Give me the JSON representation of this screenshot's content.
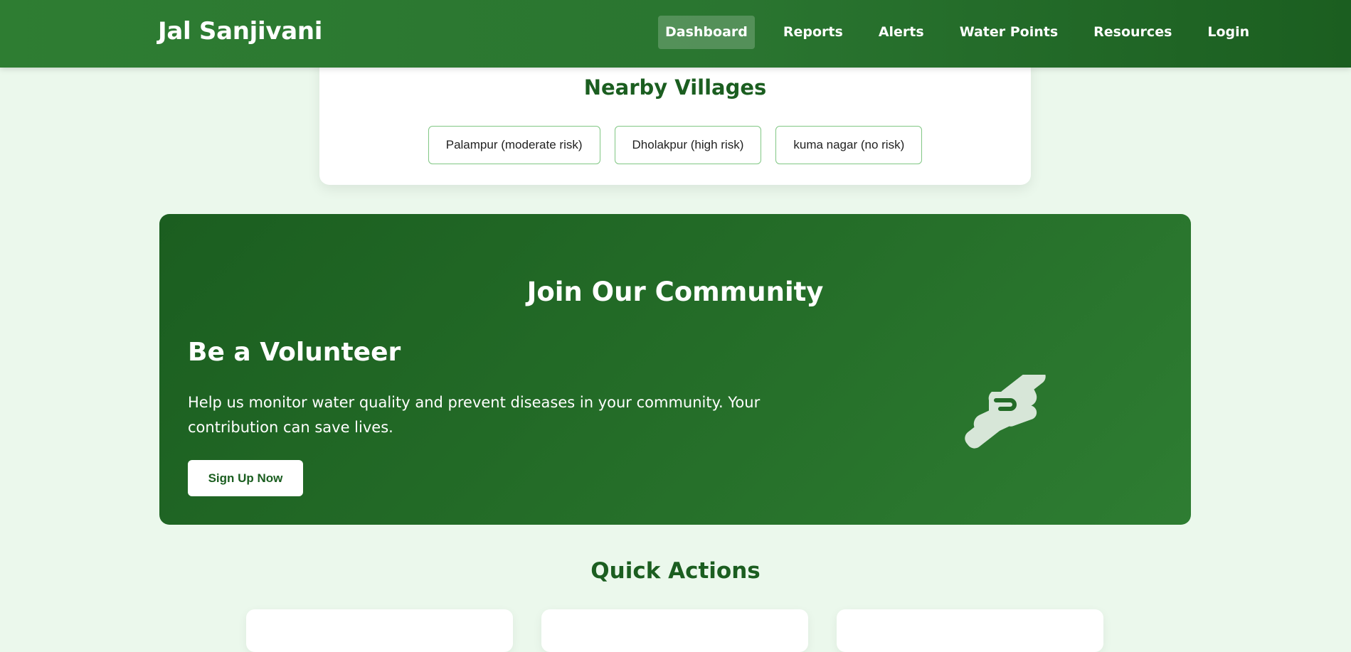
{
  "navbar": {
    "brand": "Jal Sanjivani",
    "links": [
      {
        "label": "Dashboard",
        "active": true
      },
      {
        "label": "Reports"
      },
      {
        "label": "Alerts"
      },
      {
        "label": "Water Points"
      },
      {
        "label": "Resources"
      },
      {
        "label": "Login"
      }
    ]
  },
  "nearby_villages": {
    "title": "Nearby Villages",
    "villages": [
      "Palampur (moderate risk)",
      "Dholakpur (high risk)",
      "kuma nagar (no risk)"
    ]
  },
  "community": {
    "title": "Join Our Community",
    "volunteer_title": "Be a Volunteer",
    "volunteer_text": "Help us monitor water quality and prevent diseases in your community. Your contribution can save lives.",
    "signup_label": "Sign Up Now",
    "icon": "handshake-icon"
  },
  "quick_actions": {
    "title": "Quick Actions"
  },
  "colors": {
    "primary": "#2e7d32",
    "primary_dark": "#1b5e20",
    "page_bg": "#ebf8ec",
    "chip_border": "#81c784"
  }
}
